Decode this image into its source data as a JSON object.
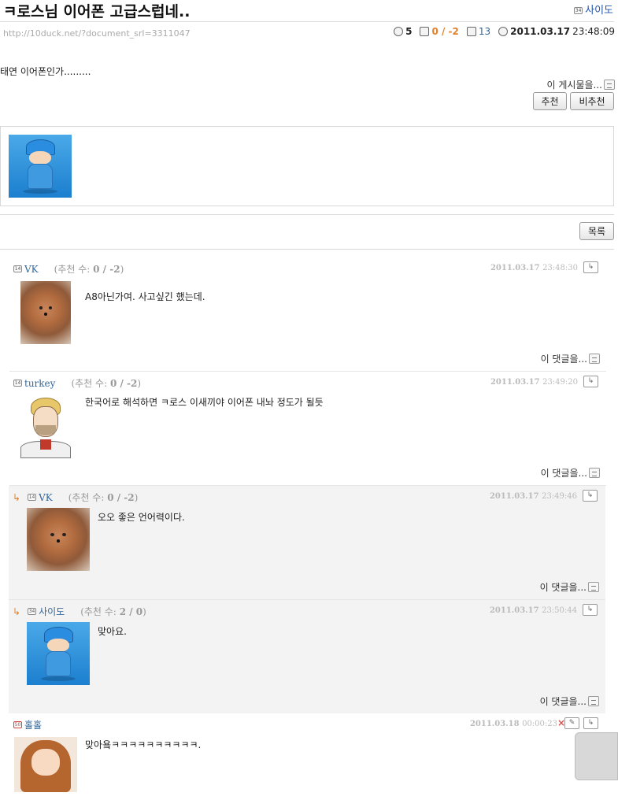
{
  "post": {
    "title": "ㅋ로스님 이어폰 고급스럽네..",
    "author": "사이도",
    "url": "http://10duck.net/?document_srl=3311047",
    "comment_count": "5",
    "votes": "0 / -2",
    "views": "13",
    "date": "2011.03.17",
    "time": "23:48:09",
    "body": "태연 이어폰인가.........",
    "this_post_label": "이 게시물을...",
    "recommend_label": "추천",
    "not_recommend_label": "비추천",
    "list_label": "목록"
  },
  "comments": [
    {
      "author": "VK",
      "votes_label": "(추천 수:",
      "votes": "0 / -2",
      "votes_close": ")",
      "date": "2011.03.17",
      "time": "23:48:30",
      "text": "A8아닌가여. 사고싶긴 했는데.",
      "this_comment_label": "이 댓글을...",
      "is_reply": false,
      "avatar": "dog"
    },
    {
      "author": "turkey",
      "votes_label": "(추천 수:",
      "votes": "0 / -2",
      "votes_close": ")",
      "date": "2011.03.17",
      "time": "23:49:20",
      "text": "한국어로 해석하면 ㅋ로스 이새끼야 이어폰 내놔 정도가 될듯",
      "this_comment_label": "이 댓글을...",
      "is_reply": false,
      "avatar": "dude"
    },
    {
      "author": "VK",
      "votes_label": "(추천 수:",
      "votes": "0 / -2",
      "votes_close": ")",
      "date": "2011.03.17",
      "time": "23:49:46",
      "text": "오오 좋은 언어력이다.",
      "this_comment_label": "이 댓글을...",
      "is_reply": true,
      "avatar": "dog"
    },
    {
      "author": "사이도",
      "votes_label": "(추천 수:",
      "votes": "2 / 0",
      "votes_close": ")",
      "date": "2011.03.17",
      "time": "23:50:44",
      "text": "맞아요.",
      "this_comment_label": "이 댓글을...",
      "is_reply": true,
      "avatar": "pocoyo"
    },
    {
      "author": "홀홀",
      "date": "2011.03.18",
      "time": "00:00:23",
      "text": "맞아욬ㅋㅋㅋㅋㅋㅋㅋㅋㅋㅋ.",
      "is_reply": false,
      "avatar": "girl"
    }
  ],
  "icons": {
    "reply": "reply-arrow-icon",
    "level": "member-level-icon",
    "comment": "speech-bubble-icon",
    "vote": "vote-icon",
    "view": "document-icon",
    "clock": "clock-icon",
    "delete": "x-icon",
    "edit": "eraser-icon"
  },
  "colors": {
    "link": "#336699",
    "vote_accent": "#e0822c",
    "delete": "#d9534f",
    "reply_bg": "#f3f3f3"
  }
}
